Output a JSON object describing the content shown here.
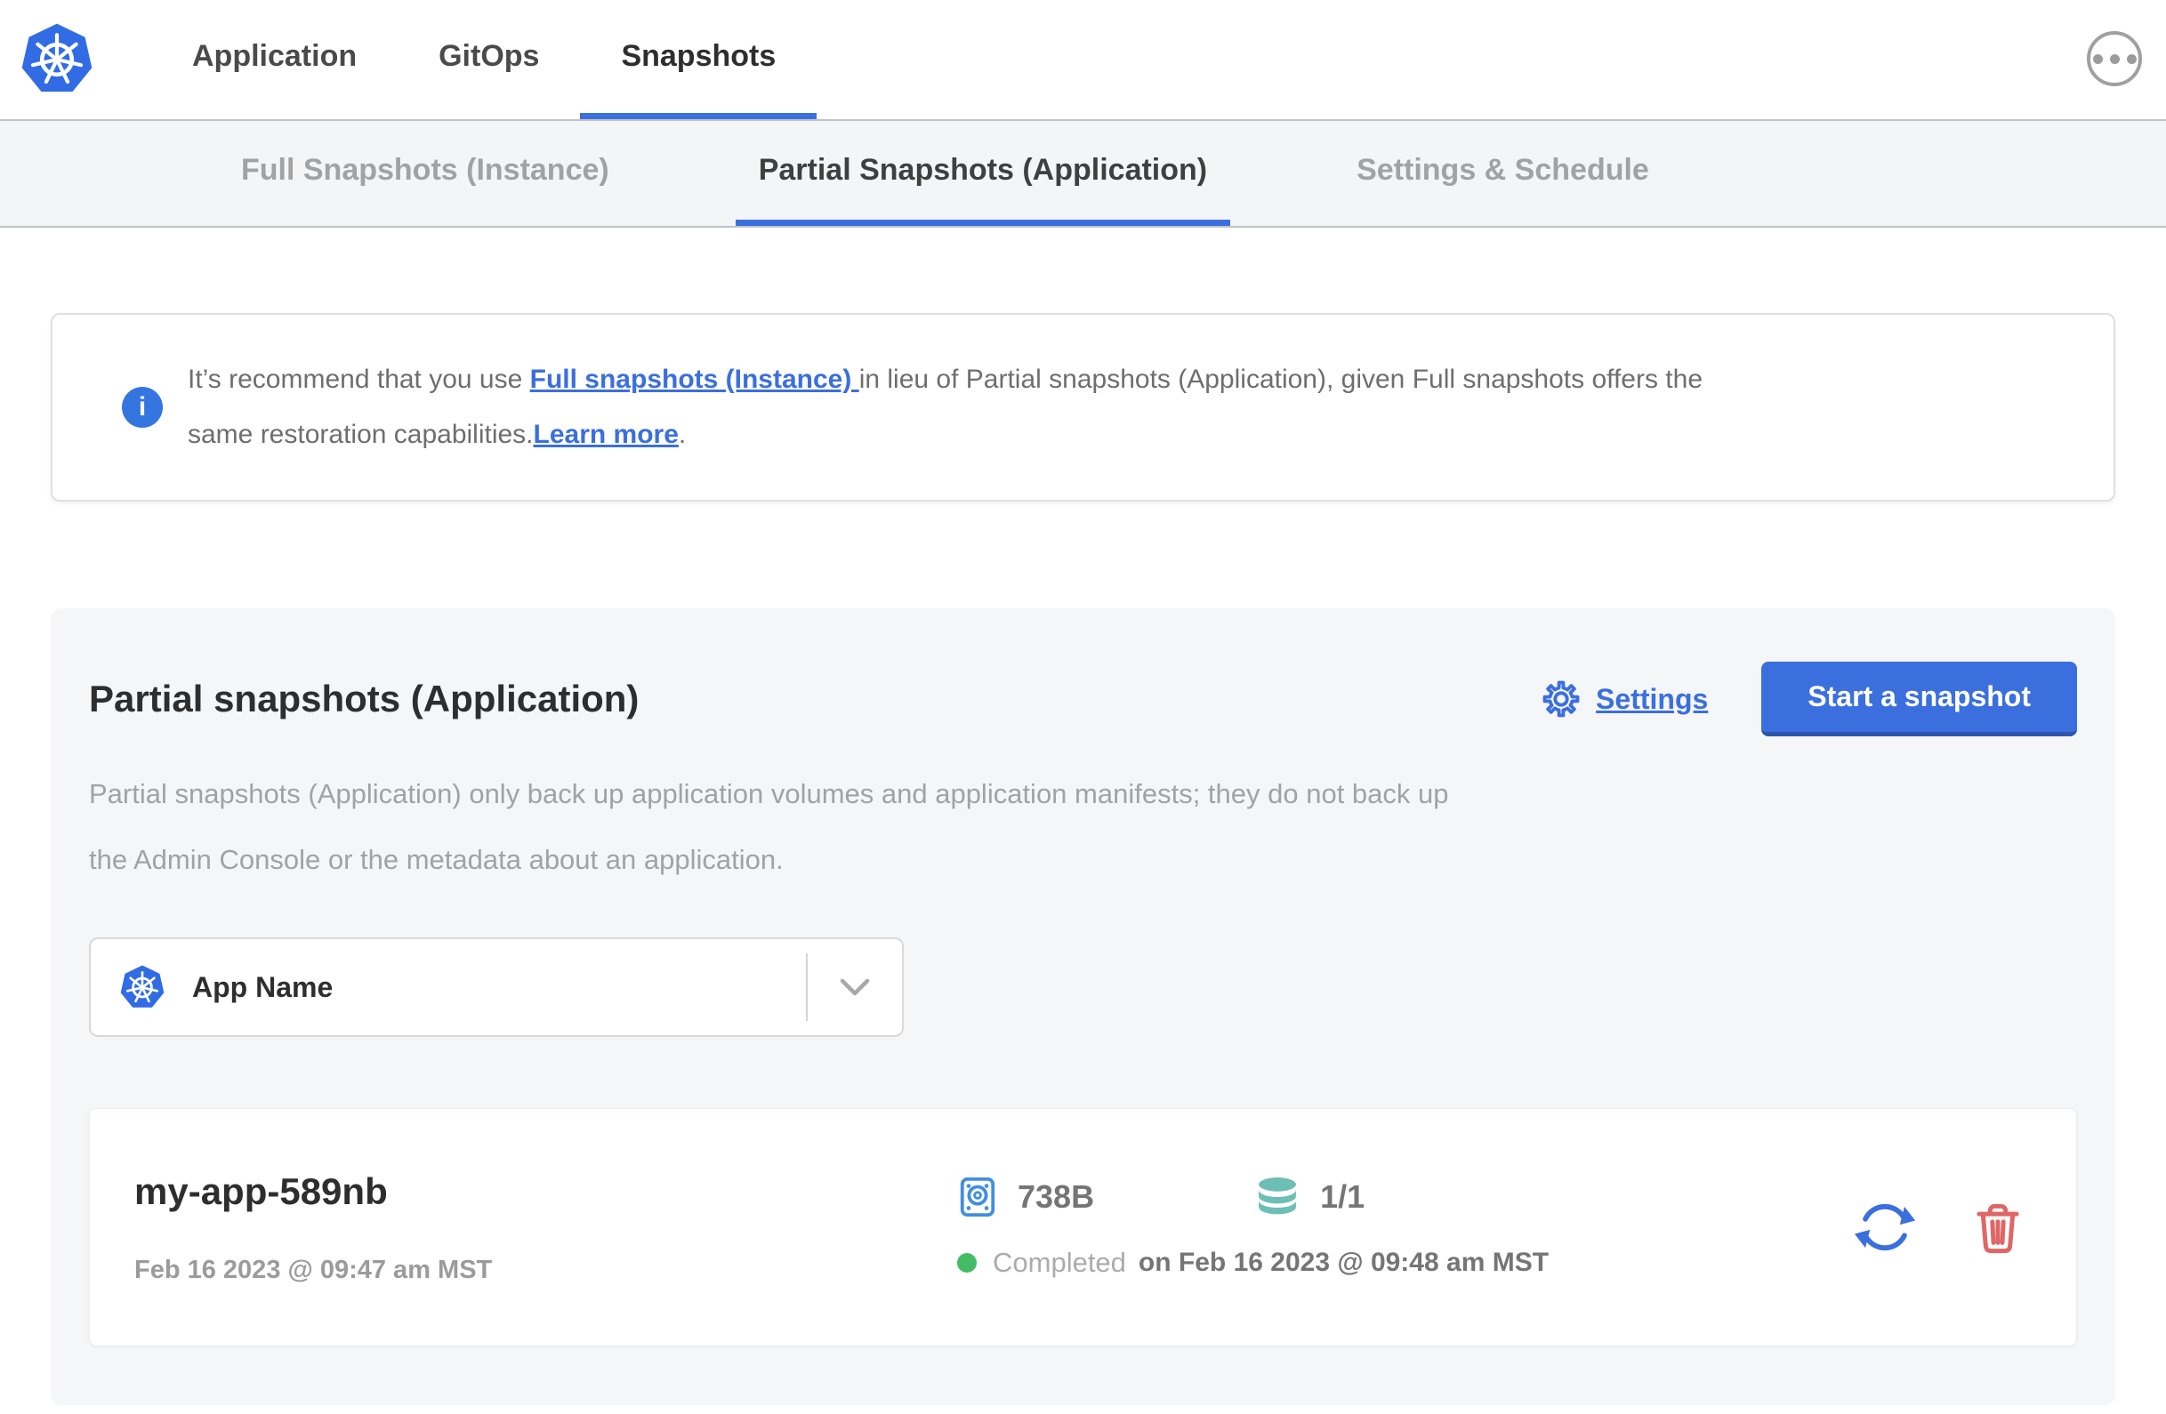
{
  "topnav": {
    "logo_icon": "kubernetes-wheel-icon",
    "tabs": [
      {
        "label": "Application",
        "active": false
      },
      {
        "label": "GitOps",
        "active": false
      },
      {
        "label": "Snapshots",
        "active": true
      }
    ],
    "overflow_menu_icon": "ellipsis-circle-icon"
  },
  "subnav": {
    "tabs": [
      {
        "label": "Full Snapshots (Instance)",
        "active": false
      },
      {
        "label": "Partial Snapshots (Application)",
        "active": true
      },
      {
        "label": "Settings & Schedule",
        "active": false
      }
    ]
  },
  "info_banner": {
    "icon": "info-circle-icon",
    "text_before_link": "It’s recommend that you use ",
    "link_full_snapshots": "Full snapshots (Instance) ",
    "text_line1_rest": "in lieu of Partial snapshots (Application), given Full snapshots offers the",
    "text_line2": "same restoration capabilities.",
    "link_learn_more": "Learn more",
    "text_after_link": "."
  },
  "panel": {
    "title": "Partial snapshots (Application)",
    "settings_icon": "gear-icon",
    "settings_label": "Settings",
    "start_snapshot_label": "Start a snapshot",
    "description_line1": "Partial snapshots (Application) only back up application volumes and application manifests; they do not back up",
    "description_line2": "the Admin Console or the metadata about an application.",
    "app_selector": {
      "icon": "kubernetes-wheel-icon",
      "selected": "App Name",
      "chevron_icon": "chevron-down-icon"
    },
    "snapshots": [
      {
        "name": "my-app-589nb",
        "started": "Feb 16 2023 @ 09:47 am MST",
        "size_icon": "hard-drive-icon",
        "size": "738B",
        "volumes_icon": "database-icon",
        "volumes": "1/1",
        "status_icon": "green-dot-icon",
        "status": "Completed",
        "status_detail": "on Feb 16 2023 @ 09:48 am MST",
        "restore_icon": "restore-arrows-icon",
        "delete_icon": "trash-icon"
      }
    ]
  },
  "colors": {
    "accent_blue": "#3b6fde",
    "kubernetes_blue": "#326ce5",
    "disk_icon_blue": "#418ee0",
    "volumes_teal": "#6dbeb5",
    "status_green": "#44bb66",
    "delete_red": "#e06666",
    "panel_background": "#f5f6f8"
  }
}
